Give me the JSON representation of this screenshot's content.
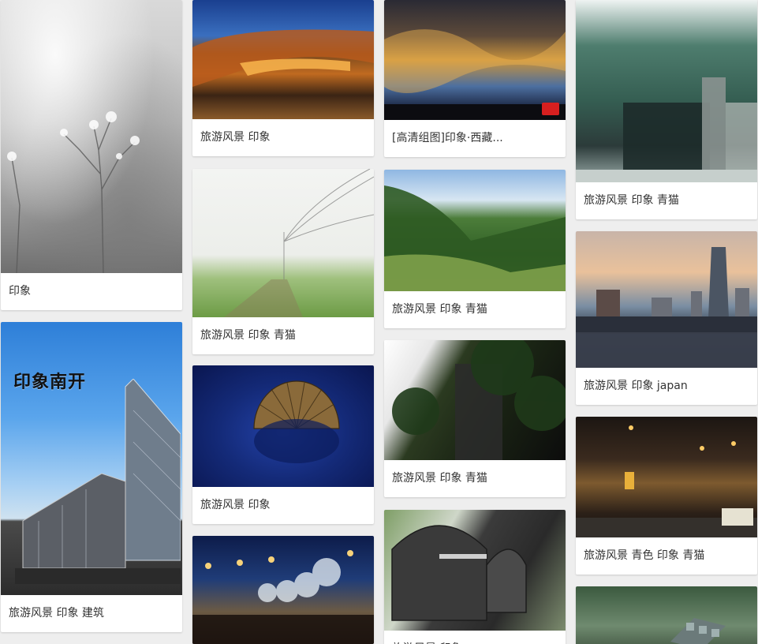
{
  "columns": [
    {
      "cards": [
        {
          "caption": "印象"
        },
        {
          "caption": "旅游风景 印象 建筑",
          "overlay_text": "印象南开"
        }
      ]
    },
    {
      "cards": [
        {
          "caption": "旅游风景 印象"
        },
        {
          "caption": "旅游风景 印象 青猫"
        },
        {
          "caption": "旅游风景 印象"
        },
        {
          "caption": ""
        }
      ]
    },
    {
      "cards": [
        {
          "caption": "[高清组图]印象·西藏..."
        },
        {
          "caption": "旅游风景 印象 青猫"
        },
        {
          "caption": "旅游风景 印象 青猫"
        },
        {
          "caption": "旅游风景 印象"
        }
      ]
    },
    {
      "cards": [
        {
          "caption": "旅游风景 印象 青猫"
        },
        {
          "caption": "旅游风景 印象 japan"
        },
        {
          "caption": "旅游风景 青色 印象 青猫"
        },
        {
          "caption": ""
        }
      ]
    }
  ]
}
